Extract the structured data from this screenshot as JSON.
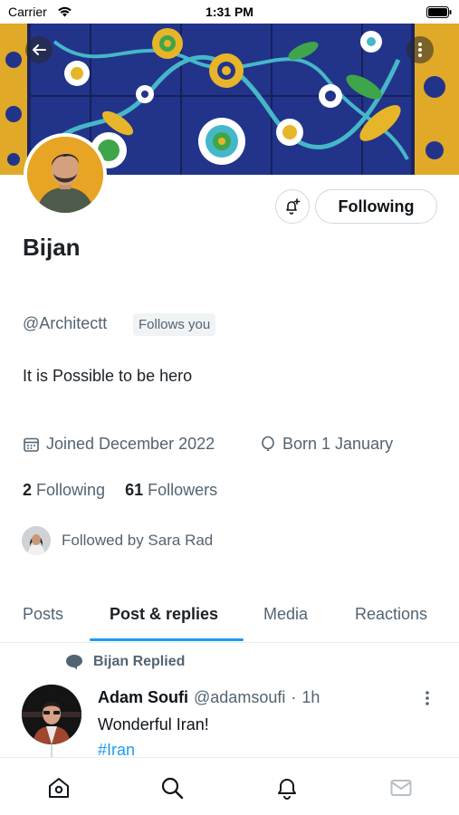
{
  "status_bar": {
    "carrier": "Carrier",
    "time": "1:31 PM"
  },
  "profile": {
    "display_name": "Bijan",
    "handle": "@Architectt",
    "follows_you_badge": "Follows you",
    "bio": "It is Possible to be hero",
    "joined": "Joined December 2022",
    "born": "Born 1 January",
    "following_count": "2",
    "following_label": "Following",
    "followers_count": "61",
    "followers_label": "Followers",
    "followed_by": "Followed by Sara Rad"
  },
  "actions": {
    "following_button": "Following"
  },
  "tabs": [
    {
      "label": "Posts"
    },
    {
      "label": "Post & replies"
    },
    {
      "label": "Media"
    },
    {
      "label": "Reactions"
    }
  ],
  "active_tab": "Post & replies",
  "post": {
    "context_name": "Bijan",
    "context_action": "Replied",
    "author_name": "Adam Soufi",
    "author_handle": "@adamsoufi",
    "time": "1h",
    "text": "Wonderful Iran!",
    "hashtag": "#Iran"
  },
  "colors": {
    "accent": "#1d9bf0",
    "secondary_text": "#536471",
    "banner_blue": "#22348a",
    "banner_yellow": "#e7b52a"
  },
  "icons": {
    "nav": [
      "home-icon",
      "search-icon",
      "bell-icon",
      "mail-icon"
    ]
  }
}
